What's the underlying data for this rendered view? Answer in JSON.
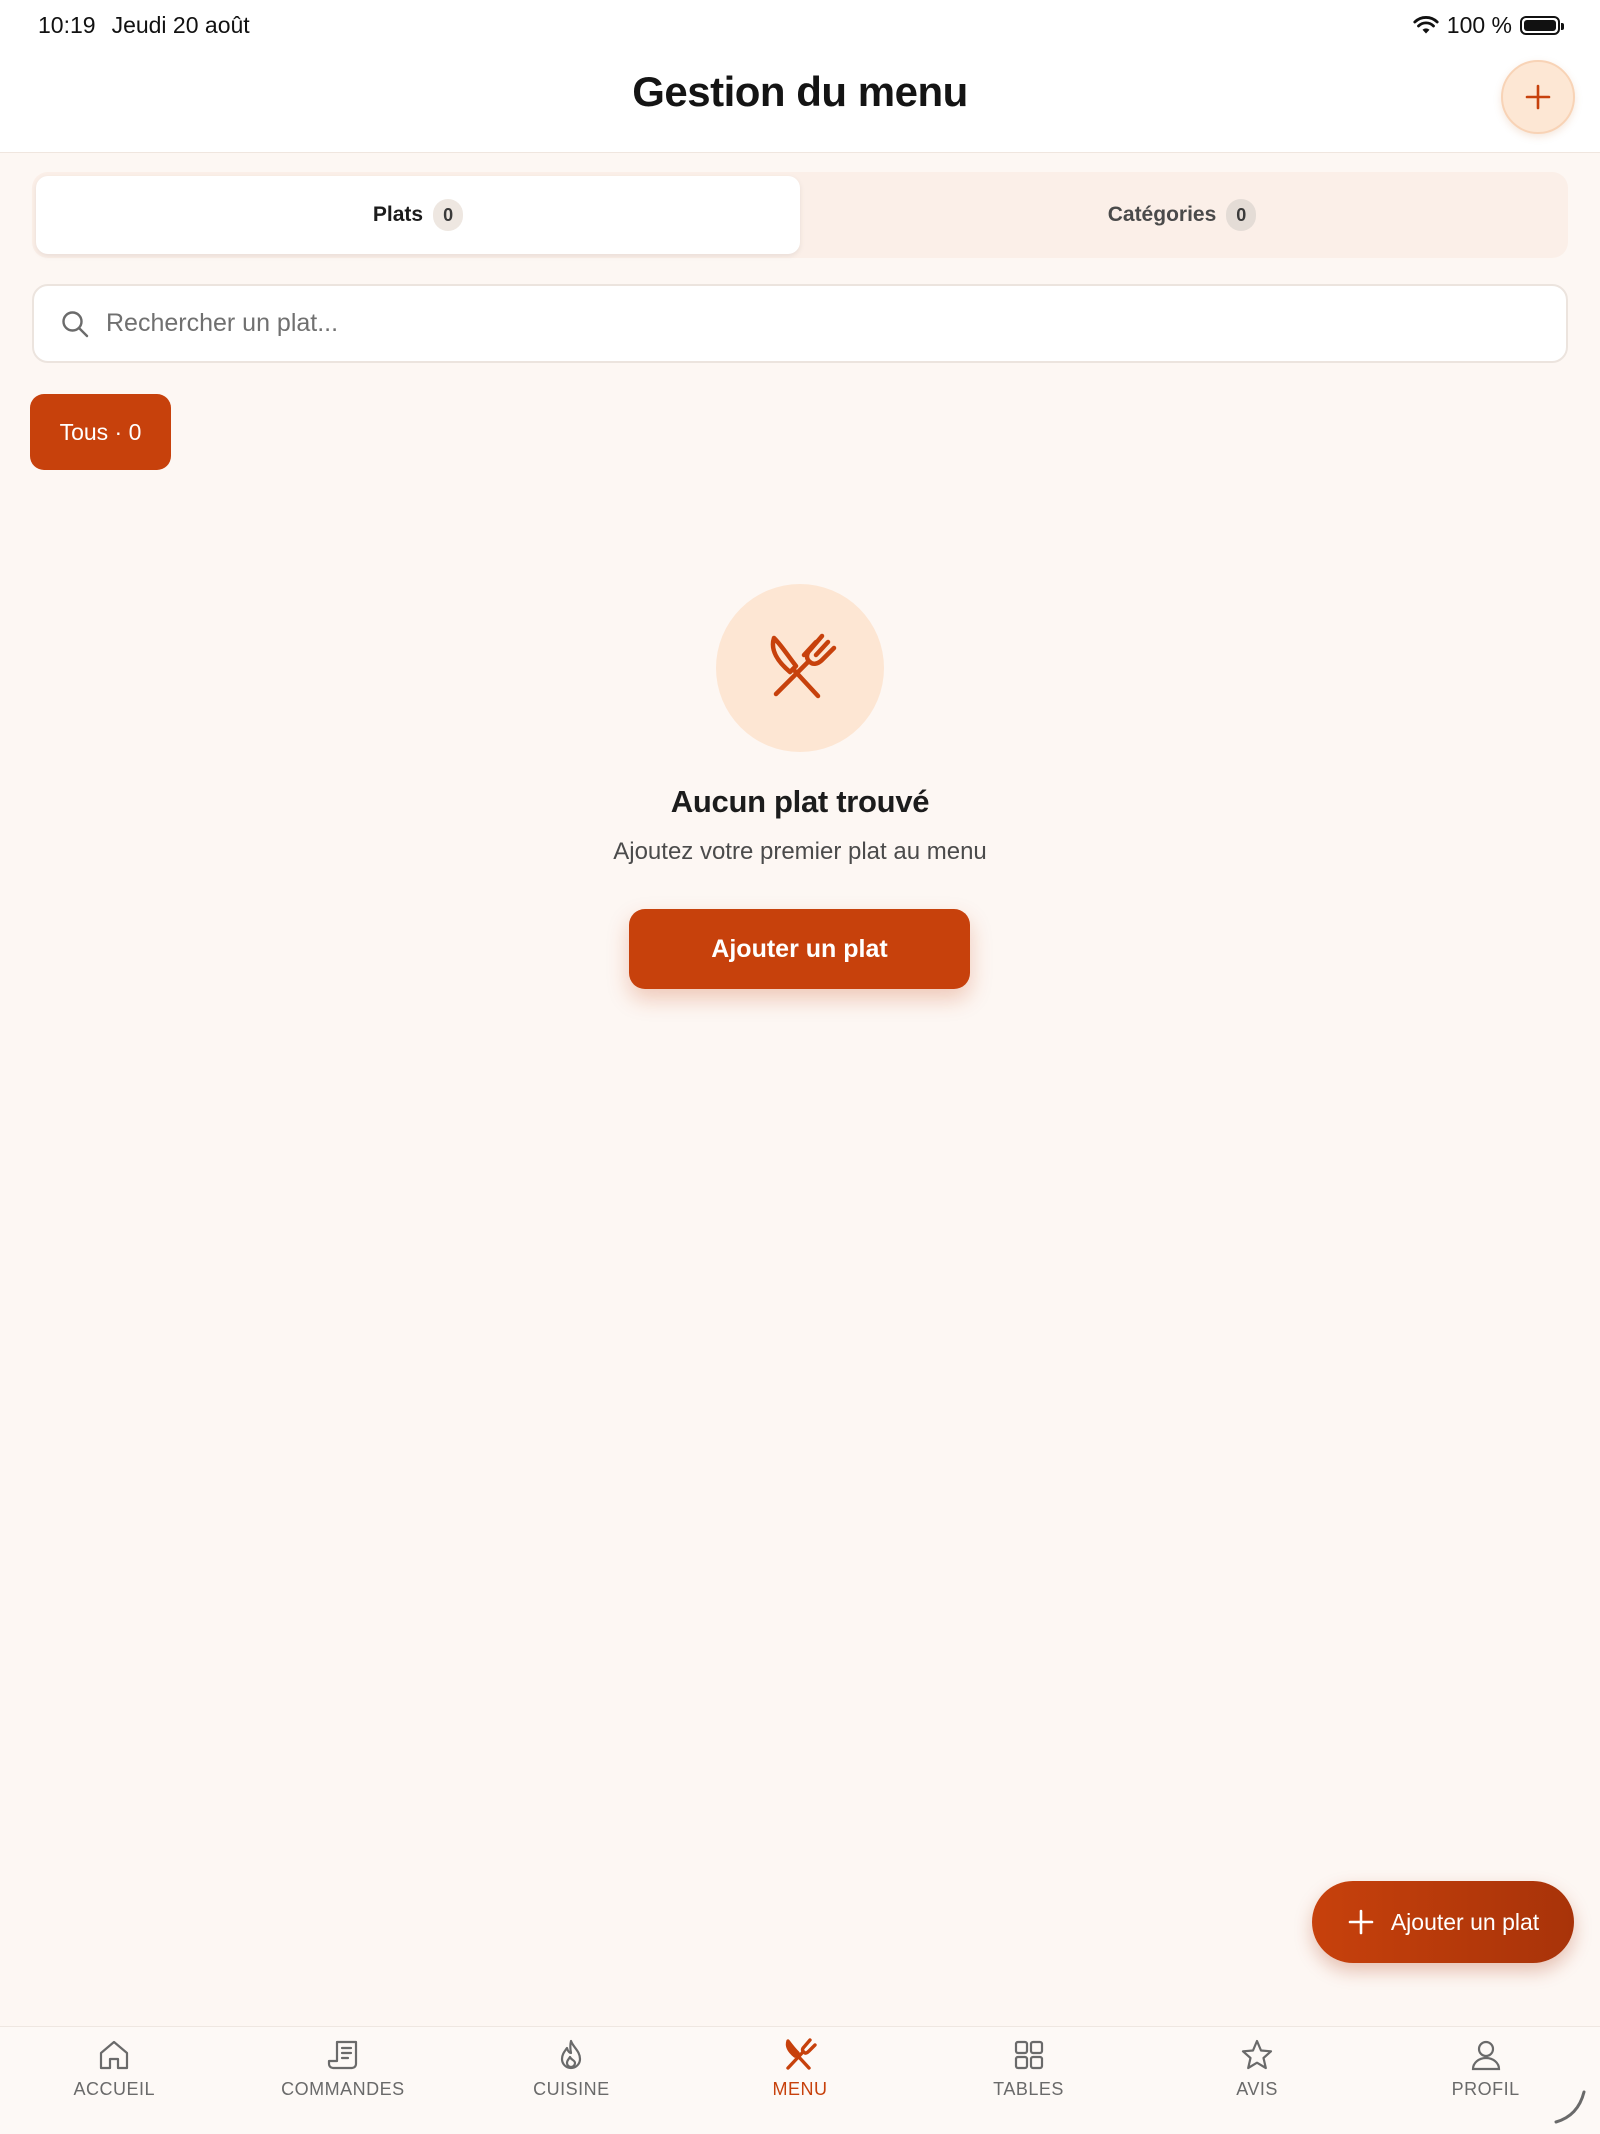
{
  "status": {
    "time": "10:19",
    "date": "Jeudi 20 août",
    "battery": "100 %"
  },
  "header": {
    "title": "Gestion du menu"
  },
  "tabs": [
    {
      "label": "Plats",
      "count": "0",
      "active": true
    },
    {
      "label": "Catégories",
      "count": "0",
      "active": false
    }
  ],
  "search": {
    "placeholder": "Rechercher un plat..."
  },
  "filter": {
    "chip_label": "Tous · 0"
  },
  "empty": {
    "title": "Aucun plat trouvé",
    "subtitle": "Ajoutez votre premier plat au menu",
    "cta": "Ajouter un plat"
  },
  "fab": {
    "label": "Ajouter un plat"
  },
  "nav": [
    {
      "label": "ACCUEIL",
      "icon": "home-icon"
    },
    {
      "label": "COMMANDES",
      "icon": "receipt-icon"
    },
    {
      "label": "CUISINE",
      "icon": "flame-icon"
    },
    {
      "label": "MENU",
      "icon": "utensils-icon",
      "active": true
    },
    {
      "label": "TABLES",
      "icon": "grid-icon"
    },
    {
      "label": "AVIS",
      "icon": "star-icon"
    },
    {
      "label": "PROFIL",
      "icon": "user-icon"
    }
  ],
  "colors": {
    "accent": "#c7410c",
    "accent_soft": "#fde6d3",
    "background": "#fdf7f3"
  }
}
